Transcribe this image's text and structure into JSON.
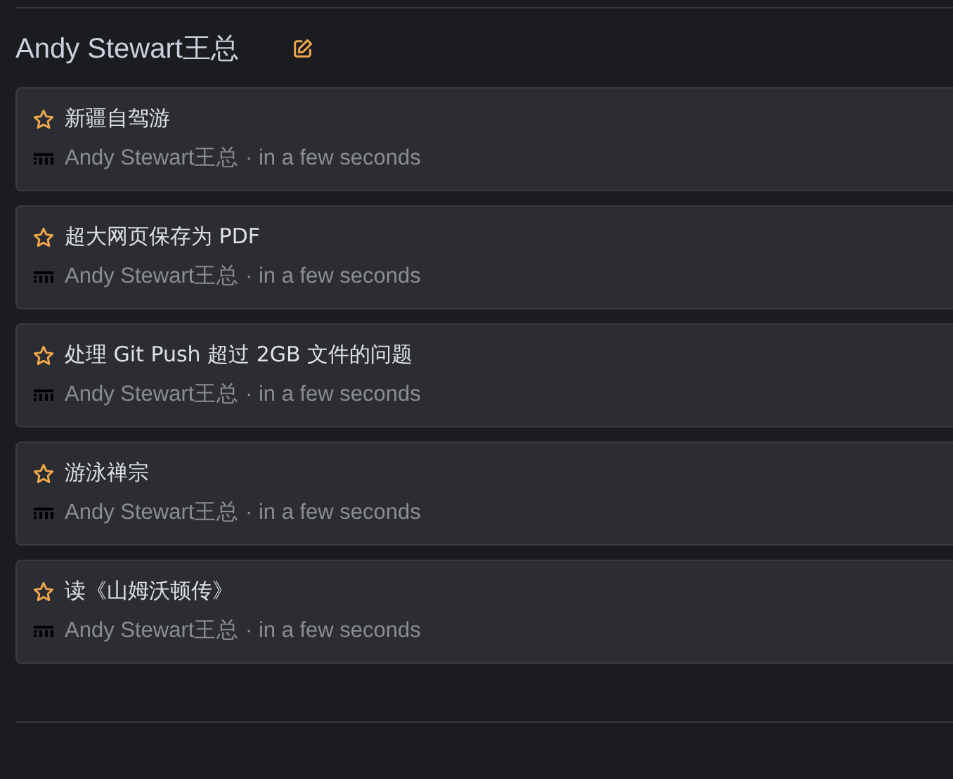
{
  "title": "Andy Stewart王总",
  "items": [
    {
      "title": "新疆自驾游",
      "starred": false,
      "meta": "Andy Stewart王总 · in a few seconds"
    },
    {
      "title": "超大网页保存为 PDF",
      "starred": false,
      "meta": "Andy Stewart王总 · in a few seconds"
    },
    {
      "title": "处理 Git Push 超过 2GB 文件的问题",
      "starred": false,
      "meta": "Andy Stewart王总 · in a few seconds"
    },
    {
      "title": "游泳禅宗",
      "starred": false,
      "meta": "Andy Stewart王总 · in a few seconds"
    },
    {
      "title": "读《山姆沃顿传》",
      "starred": false,
      "meta": "Andy Stewart王总 · in a few seconds"
    }
  ]
}
